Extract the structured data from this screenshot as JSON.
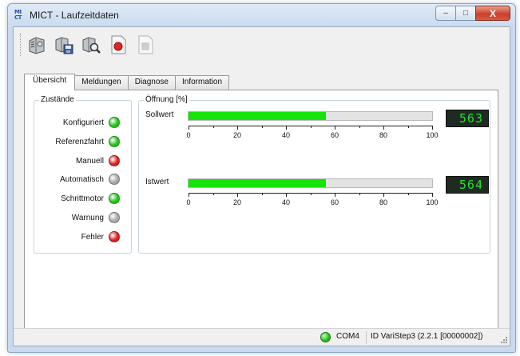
{
  "window": {
    "title": "MICT - Laufzeitdaten",
    "app_icon_text": "MI\nCT",
    "controls": {
      "minimize": "–",
      "maximize": "□",
      "close": "X"
    }
  },
  "toolbar": {
    "buttons": [
      {
        "name": "read-device-button",
        "icon": "device-icon"
      },
      {
        "name": "save-device-button",
        "icon": "device-save-icon"
      },
      {
        "name": "inspect-device-button",
        "icon": "device-search-icon"
      },
      {
        "name": "record-button",
        "icon": "record-icon",
        "enabled": true
      },
      {
        "name": "stop-button",
        "icon": "stop-icon",
        "enabled": false
      }
    ]
  },
  "tabs": [
    {
      "label": "Übersicht",
      "active": true
    },
    {
      "label": "Meldungen",
      "active": false
    },
    {
      "label": "Diagnose",
      "active": false
    },
    {
      "label": "Information",
      "active": false
    }
  ],
  "states": {
    "title": "Zustände",
    "items": [
      {
        "label": "Konfiguriert",
        "color": "#22c41a"
      },
      {
        "label": "Referenzfahrt",
        "color": "#22c41a"
      },
      {
        "label": "Manuell",
        "color": "#e01e1e"
      },
      {
        "label": "Automatisch",
        "color": "#a8a8a8"
      },
      {
        "label": "Schrittmotor",
        "color": "#22c41a"
      },
      {
        "label": "Warnung",
        "color": "#a8a8a8"
      },
      {
        "label": "Fehler",
        "color": "#e01e1e"
      }
    ]
  },
  "opening": {
    "title": "Öffnung [%]",
    "scale": {
      "min": 0,
      "max": 100,
      "ticks": [
        "0",
        "20",
        "40",
        "60",
        "80",
        "100"
      ]
    },
    "sollwert": {
      "label": "Sollwert",
      "value": 56.3,
      "display": "563"
    },
    "istwert": {
      "label": "Istwert",
      "value": 56.4,
      "display": "564"
    }
  },
  "statusbar": {
    "connection_color": "#18c40e",
    "port": "COM4",
    "device": "ID VariStep3 (2.2.1 [00000002])"
  }
}
